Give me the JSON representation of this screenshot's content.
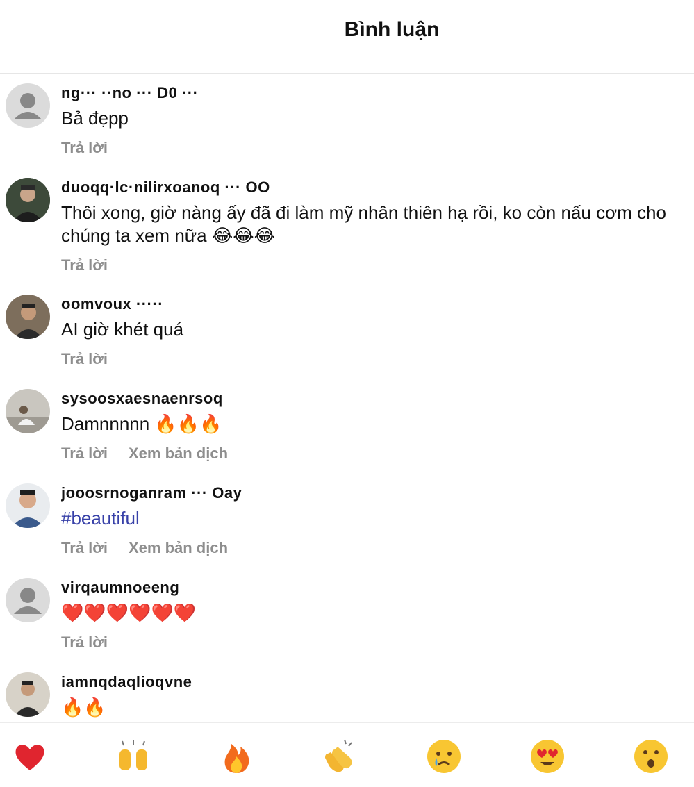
{
  "header": {
    "title": "Bình luận"
  },
  "comments": [
    {
      "username": "ng··· ··no ··· D0 ···",
      "text": "Bả đẹpp",
      "reply": "Trả lời",
      "translate": "",
      "avatar": "default-avatar-icon"
    },
    {
      "username": "duoqq·lc·nilirxoanoq ··· OO",
      "text": "Thôi xong, giờ nàng ấy đã đi làm mỹ nhân thiên hạ rồi, ko còn nấu cơm cho chúng ta xem nữa 😂😂😂",
      "reply": "Trả lời",
      "translate": "",
      "avatar": "photo-avatar"
    },
    {
      "username": "oomvoux ·····",
      "text": "AI giờ khét quá",
      "reply": "Trả lời",
      "translate": "",
      "avatar": "photo-avatar"
    },
    {
      "username": "sysoosxaesnaenrsoq",
      "text": "Damnnnnn 🔥🔥🔥",
      "reply": "Trả lời",
      "translate": "Xem bản dịch",
      "avatar": "photo-avatar"
    },
    {
      "username": "jooosrnoganram ··· Oay",
      "text": "#beautiful",
      "reply": "Trả lời",
      "translate": "Xem bản dịch",
      "avatar": "photo-avatar"
    },
    {
      "username": "virqaumnoeeng",
      "text": "❤️❤️❤️❤️❤️❤️",
      "reply": "Trả lời",
      "translate": "",
      "avatar": "default-avatar-icon"
    },
    {
      "username": "iamnqdaqlioqvne",
      "text": "🔥🔥",
      "reply": "",
      "translate": "",
      "avatar": "photo-avatar"
    }
  ],
  "reactions": [
    "heart-reaction-icon",
    "raised-hands-reaction-icon",
    "fire-reaction-icon",
    "clapping-reaction-icon",
    "crying-reaction-icon",
    "heart-eyes-reaction-icon",
    "surprised-reaction-icon"
  ],
  "colors": {
    "hashtag": "#3740a8",
    "muted": "#8e8e8e",
    "divider": "#e6e6e6"
  }
}
